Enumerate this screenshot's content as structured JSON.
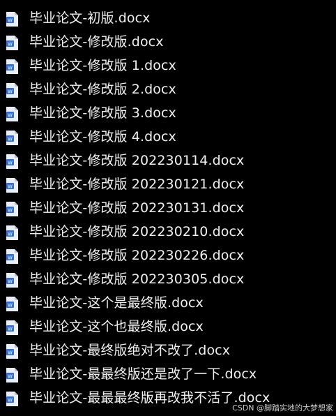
{
  "files": [
    {
      "name": "毕业论文-初版.docx",
      "icon": "word-document-icon"
    },
    {
      "name": "毕业论文-修改版.docx",
      "icon": "word-document-icon"
    },
    {
      "name": "毕业论文-修改版 1.docx",
      "icon": "word-document-icon"
    },
    {
      "name": "毕业论文-修改版 2.docx",
      "icon": "word-document-icon"
    },
    {
      "name": "毕业论文-修改版 3.docx",
      "icon": "word-document-icon"
    },
    {
      "name": "毕业论文-修改版 4.docx",
      "icon": "word-document-icon"
    },
    {
      "name": "毕业论文-修改版 202230114.docx",
      "icon": "word-document-icon"
    },
    {
      "name": "毕业论文-修改版 202230121.docx",
      "icon": "word-document-icon"
    },
    {
      "name": "毕业论文-修改版 202230131.docx",
      "icon": "word-document-icon"
    },
    {
      "name": "毕业论文-修改版 202230210.docx",
      "icon": "word-document-icon"
    },
    {
      "name": "毕业论文-修改版 202230226.docx",
      "icon": "word-document-icon"
    },
    {
      "name": "毕业论文-修改版 202230305.docx",
      "icon": "word-document-icon"
    },
    {
      "name": "毕业论文-这个是最终版.docx",
      "icon": "word-document-icon"
    },
    {
      "name": "毕业论文-这个也最终版.docx",
      "icon": "word-document-icon"
    },
    {
      "name": "毕业论文-最终版绝对不改了.docx",
      "icon": "word-document-icon"
    },
    {
      "name": "毕业论文-最最终版还是改了一下.docx",
      "icon": "word-document-icon"
    },
    {
      "name": "毕业论文-最最最终版再改我不活了.docx",
      "icon": "word-document-icon"
    }
  ],
  "watermark": "CSDN @脚踏实地的大梦想家",
  "colors": {
    "background": "#000000",
    "text": "#f1f1f1",
    "icon_page": "#e9eef8",
    "icon_badge": "#2f6fd8"
  }
}
